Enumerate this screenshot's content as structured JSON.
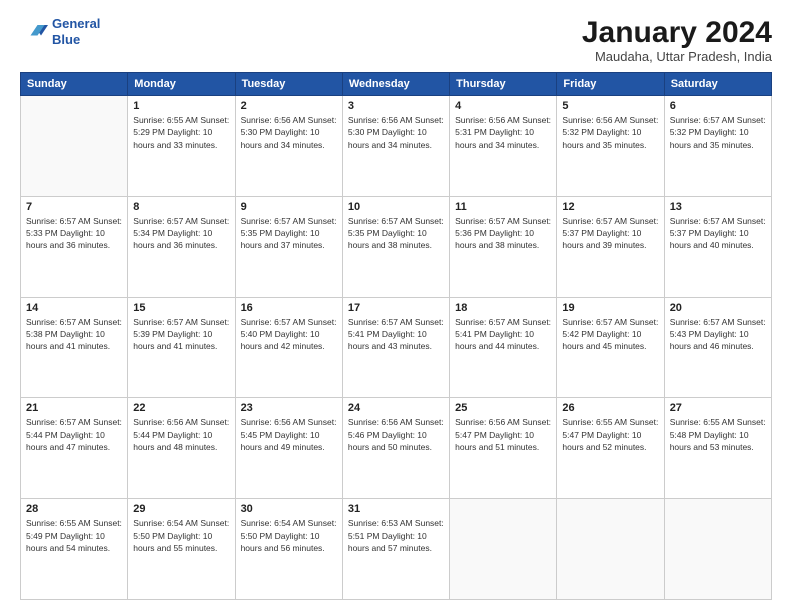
{
  "header": {
    "logo_line1": "General",
    "logo_line2": "Blue",
    "title": "January 2024",
    "subtitle": "Maudaha, Uttar Pradesh, India"
  },
  "weekdays": [
    "Sunday",
    "Monday",
    "Tuesday",
    "Wednesday",
    "Thursday",
    "Friday",
    "Saturday"
  ],
  "weeks": [
    [
      {
        "day": "",
        "info": ""
      },
      {
        "day": "1",
        "info": "Sunrise: 6:55 AM\nSunset: 5:29 PM\nDaylight: 10 hours\nand 33 minutes."
      },
      {
        "day": "2",
        "info": "Sunrise: 6:56 AM\nSunset: 5:30 PM\nDaylight: 10 hours\nand 34 minutes."
      },
      {
        "day": "3",
        "info": "Sunrise: 6:56 AM\nSunset: 5:30 PM\nDaylight: 10 hours\nand 34 minutes."
      },
      {
        "day": "4",
        "info": "Sunrise: 6:56 AM\nSunset: 5:31 PM\nDaylight: 10 hours\nand 34 minutes."
      },
      {
        "day": "5",
        "info": "Sunrise: 6:56 AM\nSunset: 5:32 PM\nDaylight: 10 hours\nand 35 minutes."
      },
      {
        "day": "6",
        "info": "Sunrise: 6:57 AM\nSunset: 5:32 PM\nDaylight: 10 hours\nand 35 minutes."
      }
    ],
    [
      {
        "day": "7",
        "info": "Sunrise: 6:57 AM\nSunset: 5:33 PM\nDaylight: 10 hours\nand 36 minutes."
      },
      {
        "day": "8",
        "info": "Sunrise: 6:57 AM\nSunset: 5:34 PM\nDaylight: 10 hours\nand 36 minutes."
      },
      {
        "day": "9",
        "info": "Sunrise: 6:57 AM\nSunset: 5:35 PM\nDaylight: 10 hours\nand 37 minutes."
      },
      {
        "day": "10",
        "info": "Sunrise: 6:57 AM\nSunset: 5:35 PM\nDaylight: 10 hours\nand 38 minutes."
      },
      {
        "day": "11",
        "info": "Sunrise: 6:57 AM\nSunset: 5:36 PM\nDaylight: 10 hours\nand 38 minutes."
      },
      {
        "day": "12",
        "info": "Sunrise: 6:57 AM\nSunset: 5:37 PM\nDaylight: 10 hours\nand 39 minutes."
      },
      {
        "day": "13",
        "info": "Sunrise: 6:57 AM\nSunset: 5:37 PM\nDaylight: 10 hours\nand 40 minutes."
      }
    ],
    [
      {
        "day": "14",
        "info": "Sunrise: 6:57 AM\nSunset: 5:38 PM\nDaylight: 10 hours\nand 41 minutes."
      },
      {
        "day": "15",
        "info": "Sunrise: 6:57 AM\nSunset: 5:39 PM\nDaylight: 10 hours\nand 41 minutes."
      },
      {
        "day": "16",
        "info": "Sunrise: 6:57 AM\nSunset: 5:40 PM\nDaylight: 10 hours\nand 42 minutes."
      },
      {
        "day": "17",
        "info": "Sunrise: 6:57 AM\nSunset: 5:41 PM\nDaylight: 10 hours\nand 43 minutes."
      },
      {
        "day": "18",
        "info": "Sunrise: 6:57 AM\nSunset: 5:41 PM\nDaylight: 10 hours\nand 44 minutes."
      },
      {
        "day": "19",
        "info": "Sunrise: 6:57 AM\nSunset: 5:42 PM\nDaylight: 10 hours\nand 45 minutes."
      },
      {
        "day": "20",
        "info": "Sunrise: 6:57 AM\nSunset: 5:43 PM\nDaylight: 10 hours\nand 46 minutes."
      }
    ],
    [
      {
        "day": "21",
        "info": "Sunrise: 6:57 AM\nSunset: 5:44 PM\nDaylight: 10 hours\nand 47 minutes."
      },
      {
        "day": "22",
        "info": "Sunrise: 6:56 AM\nSunset: 5:44 PM\nDaylight: 10 hours\nand 48 minutes."
      },
      {
        "day": "23",
        "info": "Sunrise: 6:56 AM\nSunset: 5:45 PM\nDaylight: 10 hours\nand 49 minutes."
      },
      {
        "day": "24",
        "info": "Sunrise: 6:56 AM\nSunset: 5:46 PM\nDaylight: 10 hours\nand 50 minutes."
      },
      {
        "day": "25",
        "info": "Sunrise: 6:56 AM\nSunset: 5:47 PM\nDaylight: 10 hours\nand 51 minutes."
      },
      {
        "day": "26",
        "info": "Sunrise: 6:55 AM\nSunset: 5:47 PM\nDaylight: 10 hours\nand 52 minutes."
      },
      {
        "day": "27",
        "info": "Sunrise: 6:55 AM\nSunset: 5:48 PM\nDaylight: 10 hours\nand 53 minutes."
      }
    ],
    [
      {
        "day": "28",
        "info": "Sunrise: 6:55 AM\nSunset: 5:49 PM\nDaylight: 10 hours\nand 54 minutes."
      },
      {
        "day": "29",
        "info": "Sunrise: 6:54 AM\nSunset: 5:50 PM\nDaylight: 10 hours\nand 55 minutes."
      },
      {
        "day": "30",
        "info": "Sunrise: 6:54 AM\nSunset: 5:50 PM\nDaylight: 10 hours\nand 56 minutes."
      },
      {
        "day": "31",
        "info": "Sunrise: 6:53 AM\nSunset: 5:51 PM\nDaylight: 10 hours\nand 57 minutes."
      },
      {
        "day": "",
        "info": ""
      },
      {
        "day": "",
        "info": ""
      },
      {
        "day": "",
        "info": ""
      }
    ]
  ]
}
